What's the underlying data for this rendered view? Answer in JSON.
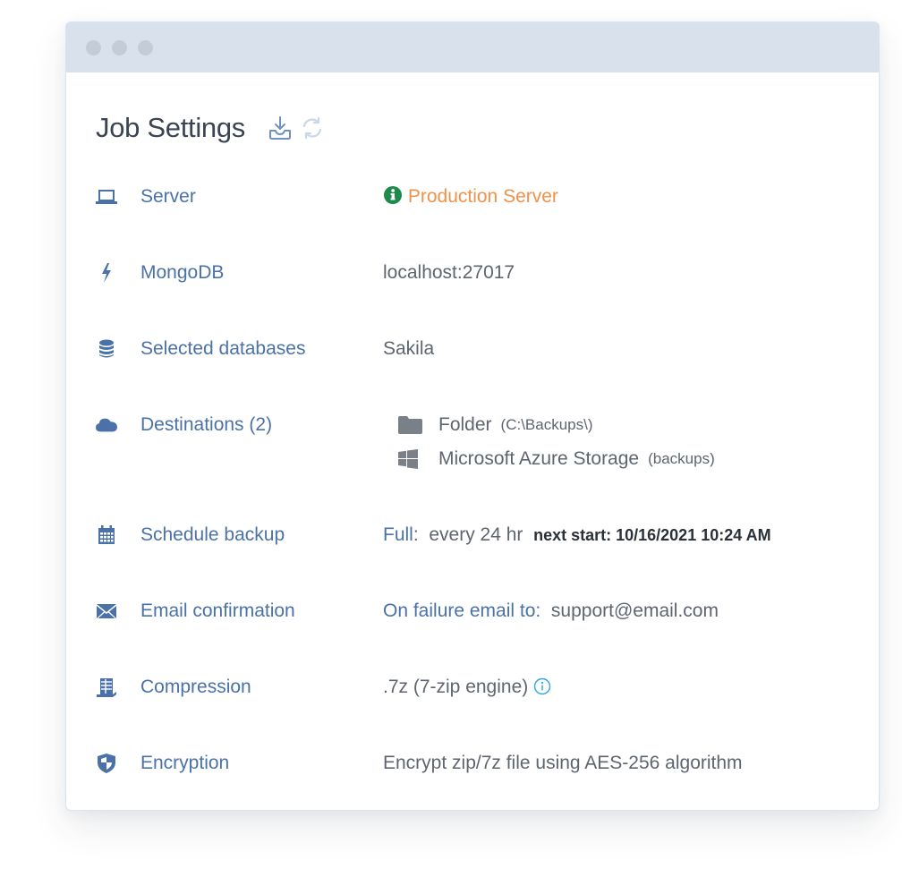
{
  "window": {
    "title_dots": [
      "close",
      "minimize",
      "maximize"
    ]
  },
  "header": {
    "title": "Job Settings",
    "actions": [
      {
        "name": "download-icon",
        "color": "#4a72a8"
      },
      {
        "name": "refresh-icon",
        "color": "#c9d7e8"
      }
    ]
  },
  "colors": {
    "label": "#4a72a8",
    "value": "#5e6570",
    "warning_text": "#f0924a",
    "info_green": "#1e8a4c",
    "info_blue": "#2aa6e8",
    "titlebar": "#d9e2ec"
  },
  "settings": [
    {
      "icon": "laptop-icon",
      "label": "Server",
      "value": "Production Server",
      "value_icon": "info-circle-icon"
    },
    {
      "icon": "bolt-icon",
      "label": "MongoDB",
      "value": "localhost:27017"
    },
    {
      "icon": "database-icon",
      "label": "Selected databases",
      "value": "Sakila"
    },
    {
      "icon": "cloud-icon",
      "label": "Destinations (2)",
      "destinations": [
        {
          "icon": "folder-icon",
          "name": "Folder",
          "detail": "(C:\\Backups\\)"
        },
        {
          "icon": "windows-icon",
          "name": "Microsoft Azure Storage",
          "detail": "(backups)"
        }
      ]
    },
    {
      "icon": "calendar-icon",
      "label": "Schedule backup",
      "value_type": "Full",
      "value_sep": ":",
      "value_interval": "every 24 hr",
      "value_next": "next start: 10/16/2021 10:24 AM"
    },
    {
      "icon": "envelope-icon",
      "label": "Email confirmation",
      "value_prefix": "On failure email to:",
      "value_email": "support@email.com"
    },
    {
      "icon": "archive-icon",
      "label": "Compression",
      "value": ".7z (7-zip engine)",
      "value_icon": "info-outline-icon"
    },
    {
      "icon": "shield-icon",
      "label": "Encryption",
      "value": "Encrypt zip/7z file using AES-256 algorithm"
    }
  ]
}
